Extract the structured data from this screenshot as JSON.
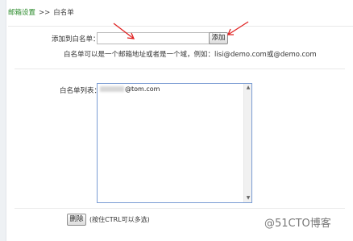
{
  "breadcrumb": {
    "parent": "邮箱设置",
    "separator": ">>",
    "current": "白名单"
  },
  "add_form": {
    "label": "添加到白名单：",
    "input_value": "",
    "add_button": "添加",
    "hint": "白名单可以是一个邮箱地址或者是一个域，例如：lisi@demo.com或@demo.com"
  },
  "whitelist": {
    "label": "白名单列表：",
    "items": [
      "@tom.com"
    ]
  },
  "actions": {
    "delete_button": "删除",
    "delete_hint": "(按住CTRL可以多选)"
  },
  "watermark": "@51CTO博客",
  "colors": {
    "breadcrumb_link": "#2a8a2a",
    "annotation_arrow": "#e02020",
    "listbox_border": "#7a9cd3"
  }
}
